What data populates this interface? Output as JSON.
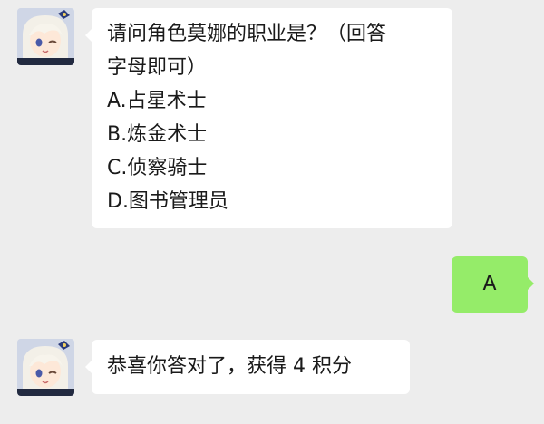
{
  "messages": [
    {
      "side": "left",
      "lines": [
        "请问角色莫娜的职业是？（回答",
        "字母即可）",
        "A.占星术士",
        "B.炼金术士",
        "C.侦察骑士",
        "D.图书管理员"
      ]
    },
    {
      "side": "right",
      "text": "A"
    },
    {
      "side": "left",
      "lines": [
        "恭喜你答对了，获得 4 积分"
      ]
    }
  ],
  "avatar_icon": "anime-girl-avatar-icon",
  "colors": {
    "background": "#ededed",
    "incoming_bubble": "#ffffff",
    "outgoing_bubble": "#95ec69",
    "text": "#1a1a1a"
  }
}
